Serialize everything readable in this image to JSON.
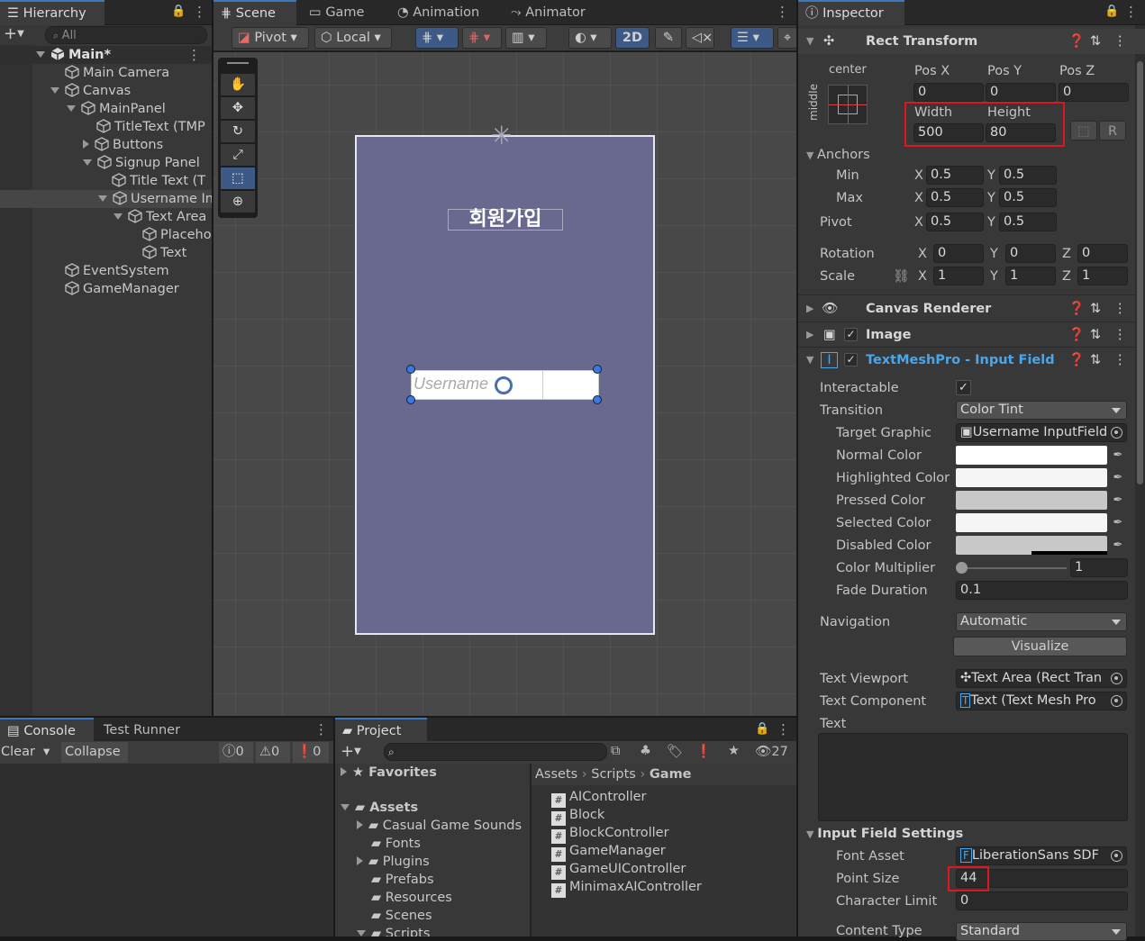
{
  "hierarchy": {
    "tab": "Hierarchy",
    "search_placeholder": "All",
    "scene": "Main*",
    "items": [
      "Main Camera",
      "Canvas",
      "MainPanel",
      "TitleText (TMP",
      "Buttons",
      "Signup Panel",
      "Title Text (T",
      "Username In",
      "Text Area",
      "Placeho",
      "Text",
      "EventSystem",
      "GameManager"
    ]
  },
  "scene_view": {
    "tabs": [
      "Scene",
      "Game",
      "Animation",
      "Animator"
    ],
    "pivot": "Pivot",
    "local": "Local",
    "mode_2d": "2D",
    "panel_title": "회원가입",
    "input_placeholder": "Username"
  },
  "inspector": {
    "tab": "Inspector",
    "rect_transform": {
      "title": "Rect Transform",
      "anchor_h": "center",
      "anchor_v": "middle",
      "pos_x_label": "Pos X",
      "pos_y_label": "Pos Y",
      "pos_z_label": "Pos Z",
      "pos_x": "0",
      "pos_y": "0",
      "pos_z": "0",
      "width_label": "Width",
      "height_label": "Height",
      "width": "500",
      "height": "80",
      "r_btn": "R",
      "anchors": "Anchors",
      "min": "Min",
      "max": "Max",
      "pivot": "Pivot",
      "x": "X",
      "y": "Y",
      "z": "Z",
      "min_x": "0.5",
      "min_y": "0.5",
      "max_x": "0.5",
      "max_y": "0.5",
      "pivot_x": "0.5",
      "pivot_y": "0.5",
      "rotation": "Rotation",
      "scale": "Scale",
      "rot_x": "0",
      "rot_y": "0",
      "rot_z": "0",
      "scale_x": "1",
      "scale_y": "1",
      "scale_z": "1"
    },
    "canvas_renderer": "Canvas Renderer",
    "image": "Image",
    "input_field": {
      "title": "TextMeshPro - Input Field",
      "interactable": "Interactable",
      "transition": "Transition",
      "transition_value": "Color Tint",
      "target_graphic": "Target Graphic",
      "target_graphic_value": "Username InputField",
      "normal": "Normal Color",
      "highlighted": "Highlighted Color",
      "pressed": "Pressed Color",
      "selected": "Selected Color",
      "disabled": "Disabled Color",
      "normal_hex": "#ffffff",
      "highlighted_hex": "#f5f5f5",
      "pressed_hex": "#c8c8c8",
      "selected_hex": "#f5f5f5",
      "disabled_hex": "#c8c8c8",
      "color_multiplier": "Color Multiplier",
      "color_multiplier_value": "1",
      "fade_duration": "Fade Duration",
      "fade_duration_value": "0.1",
      "navigation": "Navigation",
      "navigation_value": "Automatic",
      "visualize": "Visualize",
      "text_viewport": "Text Viewport",
      "text_viewport_value": "Text Area (Rect Tran",
      "text_component": "Text Component",
      "text_component_value": "Text (Text Mesh Pro",
      "text": "Text",
      "settings": "Input Field Settings",
      "font_asset": "Font Asset",
      "font_asset_value": "LiberationSans SDF",
      "point_size": "Point Size",
      "point_size_value": "44",
      "char_limit": "Character Limit",
      "char_limit_value": "0",
      "content_type": "Content Type",
      "content_type_value": "Standard"
    }
  },
  "console": {
    "tabs": [
      "Console",
      "Test Runner"
    ],
    "clear": "Clear",
    "collapse": "Collapse",
    "counts": [
      "0",
      "0",
      "0"
    ]
  },
  "project": {
    "tab": "Project",
    "count": "27",
    "favorites": "Favorites",
    "assets": "Assets",
    "folders": [
      "Casual Game Sounds",
      "Fonts",
      "Plugins",
      "Prefabs",
      "Resources",
      "Scenes",
      "Scripts"
    ],
    "breadcrumb": [
      "Assets",
      "Scripts",
      "Game"
    ],
    "files": [
      "AIController",
      "Block",
      "BlockController",
      "GameManager",
      "GameUIController",
      "MinimaxAIController"
    ]
  },
  "colors": {
    "accent": "#3a79bb",
    "scene_panel": "#69688f",
    "highlight_red": "#e0161e",
    "link_blue": "#4aa6ea"
  }
}
